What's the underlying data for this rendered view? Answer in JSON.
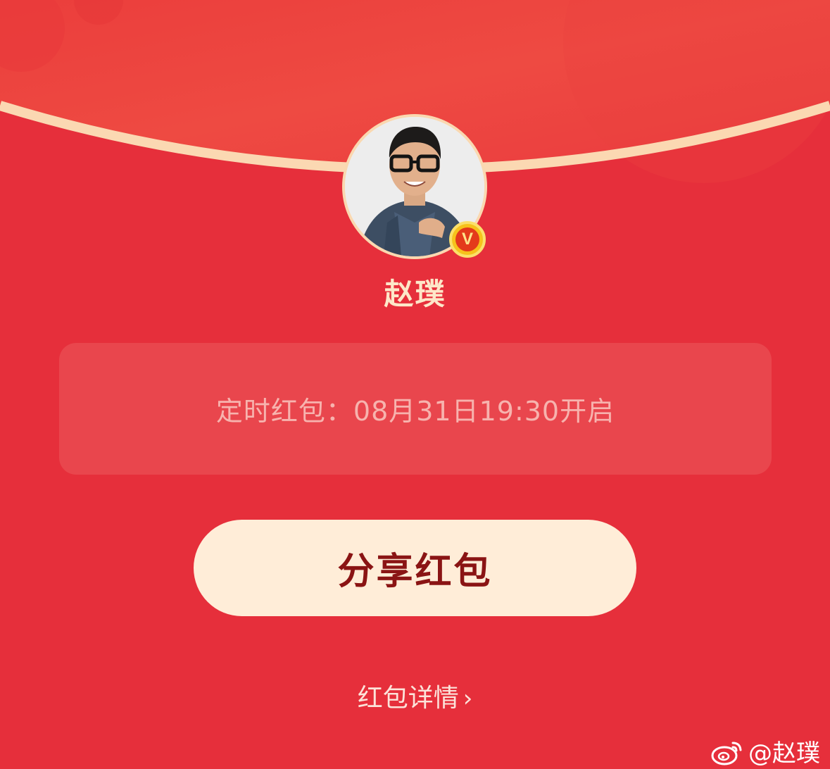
{
  "colors": {
    "background": "#E62F3B",
    "top_panel": "#EE4444",
    "arc_stroke": "#FBD8B2",
    "name_text": "#FDE7C9",
    "timer_box": "#E9464D",
    "timer_text": "#F7B3AE",
    "button_bg": "#FFEDD8",
    "button_text": "#8A1414",
    "badge_gold": "#F6C21B"
  },
  "user": {
    "name": "赵璞",
    "avatar_icon": "avatar-photo",
    "verified_icon": "verified-v-icon",
    "verified_label": "V"
  },
  "timer": {
    "text": "定时红包：08月31日19:30开启"
  },
  "share_button": {
    "label": "分享红包"
  },
  "details_link": {
    "label": "红包详情",
    "chevron": "›"
  },
  "watermark": {
    "icon": "weibo-icon",
    "text": "@赵璞"
  }
}
